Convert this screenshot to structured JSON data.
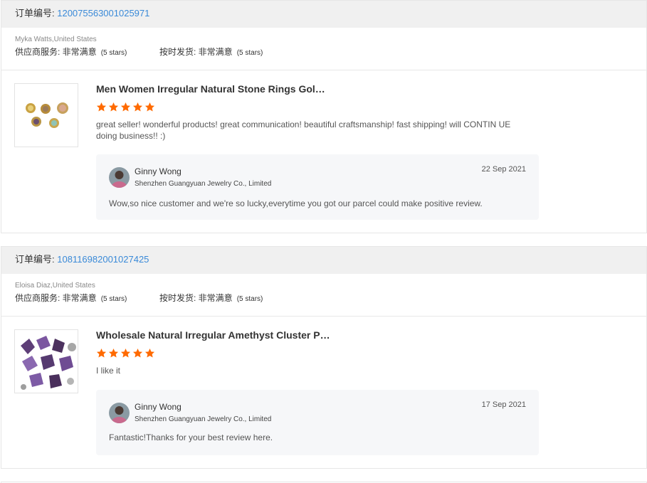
{
  "colors": {
    "accent_link": "#3a8ad8",
    "star": "#ff6a00",
    "header_bg": "#f0f0f0",
    "reply_bg": "#f6f7f9"
  },
  "orders": [
    {
      "order_label": "订单编号: ",
      "order_number": "120075563001025971",
      "buyer": "Myka Watts,United States",
      "ratings": [
        {
          "label": "供应商服务: ",
          "value": "非常满意",
          "stars_text": "(5 stars)"
        },
        {
          "label": "按时发货: ",
          "value": "非常满意",
          "stars_text": "(5 stars)"
        }
      ],
      "product_title": "Men Women Irregular Natural Stone Rings Gol…",
      "star_rating": 5,
      "review_text": "great seller! wonderful products! great communication! beautiful craftsmanship! fast shipping! will CONTIN UE doing business!! :)",
      "reply": {
        "name": "Ginny Wong",
        "company": "Shenzhen Guangyuan Jewelry Co., Limited",
        "date": "22 Sep 2021",
        "text": "Wow,so nice customer and we're so lucky,everytime you got our parcel could make positive review."
      }
    },
    {
      "order_label": "订单编号: ",
      "order_number": "108116982001027425",
      "buyer": "Eloisa Diaz,United States",
      "ratings": [
        {
          "label": "供应商服务: ",
          "value": "非常满意",
          "stars_text": "(5 stars)"
        },
        {
          "label": "按时发货: ",
          "value": "非常满意",
          "stars_text": "(5 stars)"
        }
      ],
      "product_title": "Wholesale Natural Irregular Amethyst Cluster P…",
      "star_rating": 5,
      "review_text": "I like it",
      "reply": {
        "name": "Ginny Wong",
        "company": "Shenzhen Guangyuan Jewelry Co., Limited",
        "date": "17 Sep 2021",
        "text": "Fantastic!Thanks for your best review here."
      }
    }
  ]
}
